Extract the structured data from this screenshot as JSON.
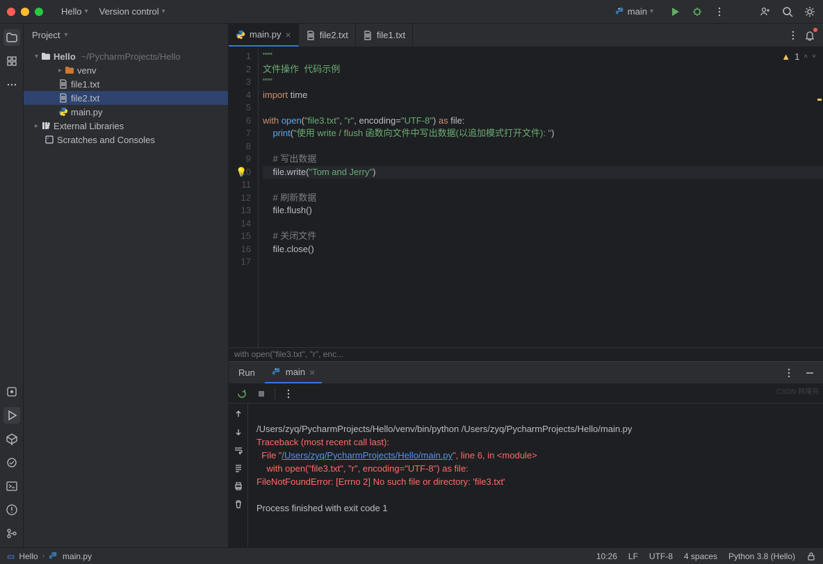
{
  "titlebar": {
    "project_menu": "Hello",
    "vcs_menu": "Version control",
    "branch": "main"
  },
  "project_panel": {
    "title": "Project",
    "root_name": "Hello",
    "root_path": "~/PycharmProjects/Hello",
    "items": [
      {
        "label": "venv",
        "type": "folder",
        "indent": 1
      },
      {
        "label": "file1.txt",
        "type": "file",
        "indent": 1
      },
      {
        "label": "file2.txt",
        "type": "file",
        "indent": 1,
        "selected": true
      },
      {
        "label": "main.py",
        "type": "py",
        "indent": 1
      }
    ],
    "external": "External Libraries",
    "scratches": "Scratches and Consoles"
  },
  "tabs": [
    {
      "label": "main.py",
      "type": "py",
      "active": true,
      "closable": true
    },
    {
      "label": "file2.txt",
      "type": "txt"
    },
    {
      "label": "file1.txt",
      "type": "txt"
    }
  ],
  "inspections": {
    "warnings": "1"
  },
  "code_lines": [
    {
      "n": "1",
      "html": "<span class='str'>\"\"\"</span>"
    },
    {
      "n": "2",
      "html": "<span class='str'>文件操作  代码示例</span>"
    },
    {
      "n": "3",
      "html": "<span class='str'>\"\"\"</span>"
    },
    {
      "n": "4",
      "html": "<span class='kw'>import</span> time"
    },
    {
      "n": "5",
      "html": ""
    },
    {
      "n": "6",
      "html": "<span class='kw'>with</span> <span class='fn'>open</span>(<span class='str'>\"file3.txt\"</span>, <span class='str'>\"r\"</span>, <span class='p'>encoding</span>=<span class='str'>\"UTF-8\"</span>) <span class='kw'>as</span> file:"
    },
    {
      "n": "7",
      "html": "    <span class='fn'>print</span>(<span class='str'>\"使用 write / flush 函数向文件中写出数据(以追加模式打开文件): \"</span>)"
    },
    {
      "n": "8",
      "html": ""
    },
    {
      "n": "9",
      "html": "    <span class='cmt'># 写出数据</span>"
    },
    {
      "n": "10",
      "html": "    file.write(<span class='str'>\"Tom and Jerry\"</span>)",
      "hl": true
    },
    {
      "n": "11",
      "html": ""
    },
    {
      "n": "12",
      "html": "    <span class='cmt'># 刷新数据</span>"
    },
    {
      "n": "13",
      "html": "    file.flush()"
    },
    {
      "n": "14",
      "html": ""
    },
    {
      "n": "15",
      "html": "    <span class='cmt'># 关闭文件</span>"
    },
    {
      "n": "16",
      "html": "    file.close()"
    },
    {
      "n": "17",
      "html": ""
    }
  ],
  "breadcrumb": "with open(\"file3.txt\", \"r\", enc...",
  "run": {
    "label": "Run",
    "config": "main",
    "output": {
      "cmd": "/Users/zyq/PycharmProjects/Hello/venv/bin/python /Users/zyq/PycharmProjects/Hello/main.py",
      "trace1": "Traceback (most recent call last):",
      "trace2a": "  File \"",
      "trace2link": "/Users/zyq/PycharmProjects/Hello/main.py",
      "trace2b": "\", line 6, in <module>",
      "trace3": "    with open(\"file3.txt\", \"r\", encoding=\"UTF-8\") as file:",
      "trace4": "FileNotFoundError: [Errno 2] No such file or directory: 'file3.txt'",
      "exit": "Process finished with exit code 1"
    }
  },
  "statusbar": {
    "crumb1": "Hello",
    "crumb2": "main.py",
    "pos": "10:26",
    "lf": "LF",
    "enc": "UTF-8",
    "indent": "4 spaces",
    "interp": "Python 3.8 (Hello)"
  }
}
